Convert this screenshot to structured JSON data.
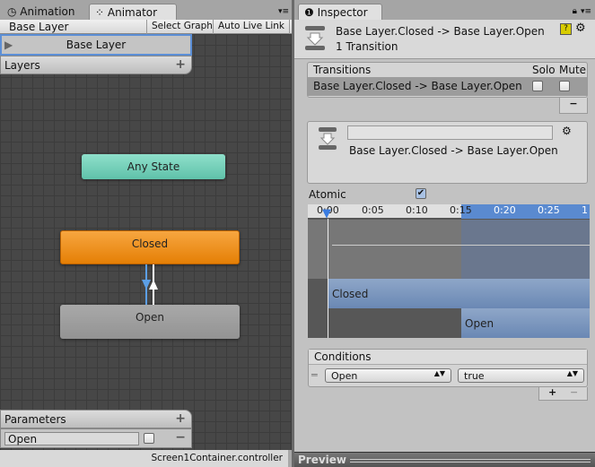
{
  "left_panel": {
    "tabs": [
      {
        "label": "Animation",
        "icon": "clock-icon"
      },
      {
        "label": "Animator",
        "icon": "animator-icon"
      }
    ],
    "breadcrumb": "Base Layer",
    "toolbar": {
      "select_graph": "Select Graph",
      "auto_live_link": "Auto Live Link"
    },
    "layer_row": "Base Layer",
    "layers_header": "Layers",
    "nodes": {
      "any_state": "Any State",
      "closed": "Closed",
      "open": "Open"
    },
    "parameters": {
      "header": "Parameters",
      "items": [
        {
          "name": "Open",
          "value": false
        }
      ]
    },
    "status": "Screen1Container.controller"
  },
  "inspector": {
    "tab": "Inspector",
    "title": "Base Layer.Closed -> Base Layer.Open",
    "subtitle": "1 Transition",
    "transitions": {
      "header": "Transitions",
      "solo": "Solo",
      "mute": "Mute",
      "rows": [
        {
          "label": "Base Layer.Closed -> Base Layer.Open",
          "solo": false,
          "mute": false
        }
      ]
    },
    "detail": {
      "name_value": "",
      "label": "Base Layer.Closed -> Base Layer.Open"
    },
    "atomic": {
      "label": "Atomic",
      "checked": true
    },
    "timeline": {
      "ticks": [
        "0:00",
        "0:05",
        "0:10",
        "0:15",
        "0:20",
        "0:25",
        "1"
      ],
      "clips": [
        "Closed",
        "Open"
      ]
    },
    "conditions": {
      "header": "Conditions",
      "rows": [
        {
          "parameter": "Open",
          "value": "true"
        }
      ]
    },
    "preview": "Preview"
  },
  "colors": {
    "any_state": "#6ecfb7",
    "closed": "#f08c12",
    "open": "#a0a0a0",
    "selection": "#5c8fd6"
  }
}
